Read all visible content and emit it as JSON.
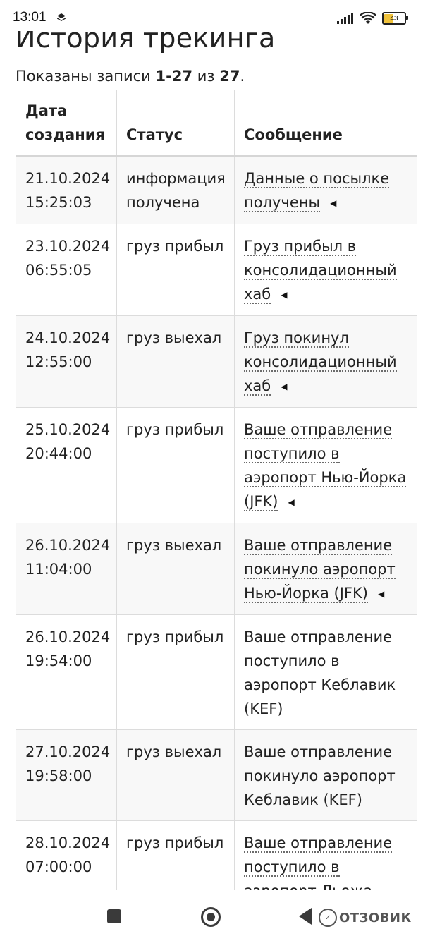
{
  "status_bar": {
    "time": "13:01",
    "battery": "43"
  },
  "page": {
    "title": "История трекинга",
    "summary_prefix": "Показаны записи ",
    "summary_range": "1-27",
    "summary_mid": " из ",
    "summary_total": "27",
    "summary_suffix": "."
  },
  "table": {
    "headers": [
      "Дата создания",
      "Статус",
      "Сообщение"
    ],
    "rows": [
      {
        "date": "21.10.2024",
        "time": "15:25:03",
        "status": "информация получена",
        "message": "Данные о посылке получены",
        "expandable": true
      },
      {
        "date": "23.10.2024",
        "time": "06:55:05",
        "status": "груз прибыл",
        "message": "Груз прибыл в консолидационный хаб",
        "expandable": true
      },
      {
        "date": "24.10.2024",
        "time": "12:55:00",
        "status": "груз выехал",
        "message": "Груз покинул консолидационный хаб",
        "expandable": true
      },
      {
        "date": "25.10.2024",
        "time": "20:44:00",
        "status": "груз прибыл",
        "message": "Ваше отправление поступило в аэропорт Нью-Йорка (JFK)",
        "expandable": true
      },
      {
        "date": "26.10.2024",
        "time": "11:04:00",
        "status": "груз выехал",
        "message": "Ваше отправление покинуло аэропорт Нью-Йорка (JFK)",
        "expandable": true
      },
      {
        "date": "26.10.2024",
        "time": "19:54:00",
        "status": "груз прибыл",
        "message": "Ваше отправление поступило в аэропорт Кеблавик (KEF)",
        "expandable": false
      },
      {
        "date": "27.10.2024",
        "time": "19:58:00",
        "status": "груз выехал",
        "message": "Ваше отправление покинуло аэропорт Кеблавик (KEF)",
        "expandable": false
      },
      {
        "date": "28.10.2024",
        "time": "07:00:00",
        "status": "груз прибыл",
        "message": "Ваше отправление поступило в аэропорт Льежа (LGG)",
        "expandable": true
      }
    ]
  },
  "watermark": {
    "text": "ОТЗОВИК"
  },
  "colors": {
    "row_odd": "#f8f8f8",
    "border": "#dcdcdc",
    "text": "#222222"
  }
}
